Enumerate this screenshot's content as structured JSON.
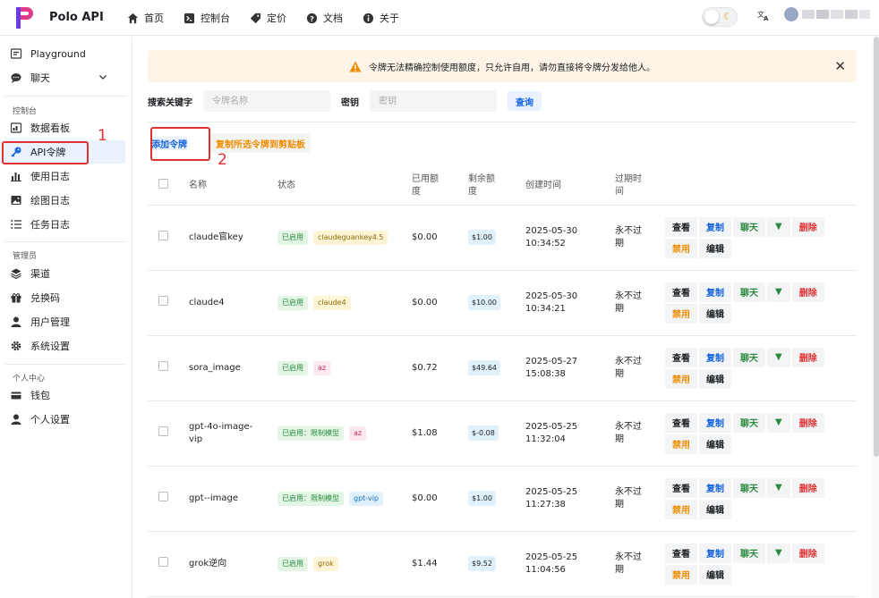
{
  "brand": {
    "name": "Polo API",
    "logo_color": "#6c3ce1"
  },
  "nav": [
    {
      "label": "首页",
      "icon": "home-icon"
    },
    {
      "label": "控制台",
      "icon": "terminal-icon"
    },
    {
      "label": "定价",
      "icon": "price-tag-icon"
    },
    {
      "label": "文档",
      "icon": "help-circle-icon"
    },
    {
      "label": "关于",
      "icon": "info-icon"
    }
  ],
  "sidebar": {
    "top": [
      {
        "label": "Playground",
        "icon": "playground-icon"
      },
      {
        "label": "聊天",
        "icon": "chat-icon"
      }
    ],
    "console_title": "控制台",
    "console": [
      {
        "label": "数据看板",
        "icon": "dashboard-icon"
      },
      {
        "label": "API令牌",
        "icon": "key-icon"
      },
      {
        "label": "使用日志",
        "icon": "bar-chart-icon"
      },
      {
        "label": "绘图日志",
        "icon": "image-icon"
      },
      {
        "label": "任务日志",
        "icon": "list-icon"
      }
    ],
    "admin_title": "管理员",
    "admin": [
      {
        "label": "渠道",
        "icon": "layers-icon"
      },
      {
        "label": "兑换码",
        "icon": "gift-icon"
      },
      {
        "label": "用户管理",
        "icon": "user-icon"
      },
      {
        "label": "系统设置",
        "icon": "settings-icon"
      }
    ],
    "personal_title": "个人中心",
    "personal": [
      {
        "label": "钱包",
        "icon": "wallet-icon"
      },
      {
        "label": "个人设置",
        "icon": "user-settings-icon"
      }
    ]
  },
  "annotations": {
    "one": "1",
    "two": "2"
  },
  "banner": {
    "text": "令牌无法精确控制使用额度，只允许自用，请勿直接将令牌分发给他人。"
  },
  "search": {
    "keyword_label": "搜索关键字",
    "keyword_placeholder": "令牌名称",
    "key_label": "密钥",
    "key_placeholder": "密钥",
    "query_button": "查询"
  },
  "actions": {
    "add": "添加令牌",
    "copy_selected": "复制所选令牌到剪贴板"
  },
  "table": {
    "headers": {
      "name": "名称",
      "status": "状态",
      "used": "已用额度",
      "remaining": "剩余额度",
      "created": "创建时间",
      "expire": "过期时间"
    },
    "ops": {
      "view": "查看",
      "copy": "复制",
      "chat": "聊天",
      "drop": "▼",
      "delete": "删除",
      "disable": "禁用",
      "edit": "编辑"
    },
    "rows": [
      {
        "name": "claude官key",
        "status": "已启用",
        "group": "claudeguankey4.5",
        "group_color": "yellow",
        "used": "$0.00",
        "remaining": "$1.00",
        "created_date": "2025-05-30",
        "created_time": "10:34:52",
        "expire": "永不过期"
      },
      {
        "name": "claude4",
        "status": "已启用",
        "group": "claude4",
        "group_color": "yellow",
        "used": "$0.00",
        "remaining": "$10.00",
        "created_date": "2025-05-30",
        "created_time": "10:34:21",
        "expire": "永不过期"
      },
      {
        "name": "sora_image",
        "status": "已启用",
        "group": "az",
        "group_color": "pink",
        "used": "$0.72",
        "remaining": "$49.64",
        "created_date": "2025-05-27",
        "created_time": "15:08:38",
        "expire": "永不过期"
      },
      {
        "name": "gpt-4o-image-vip",
        "status": "已启用：限制模型",
        "group": "az",
        "group_color": "pink",
        "used": "$1.08",
        "remaining": "$-0.08",
        "created_date": "2025-05-25",
        "created_time": "11:32:04",
        "expire": "永不过期"
      },
      {
        "name": "gpt--image",
        "status": "已启用：限制模型",
        "group": "gpt-vip",
        "group_color": "blue",
        "used": "$0.00",
        "remaining": "$1.00",
        "created_date": "2025-05-25",
        "created_time": "11:27:38",
        "expire": "永不过期"
      },
      {
        "name": "grok逆向",
        "status": "已启用",
        "group": "grok",
        "group_color": "yellow",
        "used": "$1.44",
        "remaining": "$9.52",
        "created_date": "2025-05-25",
        "created_time": "11:04:56",
        "expire": "永不过期"
      }
    ]
  }
}
